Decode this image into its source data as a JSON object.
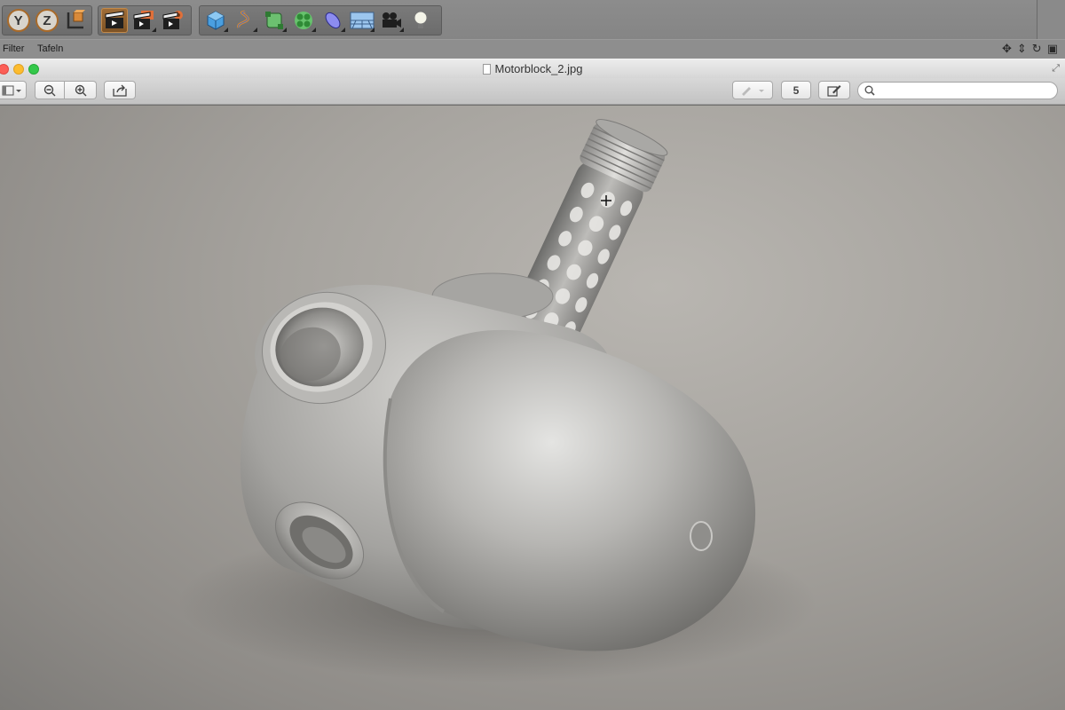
{
  "app": {
    "menu": {
      "filter": "Filter",
      "tafeln": "Tafeln"
    },
    "axis_buttons": [
      "Y",
      "Z"
    ],
    "toolbar_icons": [
      "coordinate-system-icon",
      "render-view-icon",
      "render-picture-viewer-icon",
      "render-settings-icon",
      "cube-primitive-icon",
      "spline-icon",
      "subdivision-surface-icon",
      "cloner-icon",
      "deformer-icon",
      "floor-environment-icon",
      "camera-icon",
      "light-icon"
    ],
    "nav_icons": [
      "move-view-icon",
      "zoom-view-icon",
      "rotate-view-icon",
      "view-layout-icon"
    ]
  },
  "preview": {
    "window_title": "Motorblock_2.jpg",
    "page_number": "5",
    "search": {
      "value": "",
      "placeholder": ""
    }
  },
  "colors": {
    "accent_orange": "#a86a2a",
    "traffic_close": "#fc5f57",
    "traffic_min": "#fdbc2e",
    "traffic_max": "#34c84a"
  }
}
